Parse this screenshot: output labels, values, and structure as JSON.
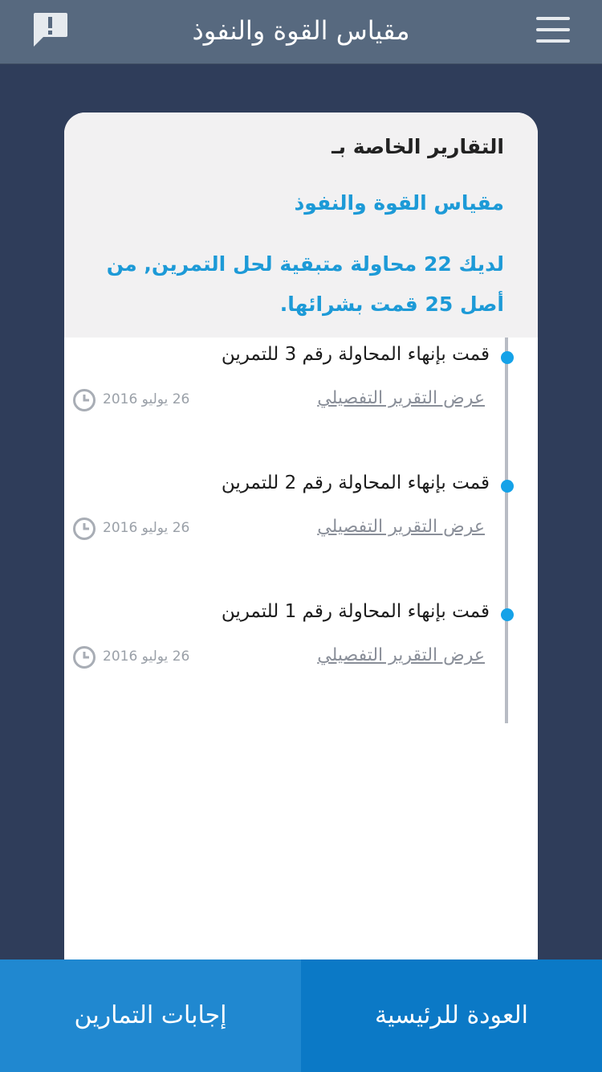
{
  "header": {
    "title": "مقياس القوة والنفوذ",
    "menu_icon": "hamburger-menu-icon",
    "report_icon": "exclamation-chat-icon"
  },
  "card": {
    "title": "التقارير الخاصة بـ",
    "subtitle": "مقياس القوة والنفوذ",
    "note": "لديك 22 محاولة متبقية لحل التمرين, من أصل 25 قمت بشرائها."
  },
  "timeline": [
    {
      "text": "قمت بإنهاء المحاولة رقم 3 للتمرين",
      "link": "عرض التقرير التفصيلي",
      "date": "26 يوليو 2016"
    },
    {
      "text": "قمت بإنهاء المحاولة رقم 2 للتمرين",
      "link": "عرض التقرير التفصيلي",
      "date": "26 يوليو 2016"
    },
    {
      "text": "قمت بإنهاء المحاولة رقم 1 للتمرين",
      "link": "عرض التقرير التفصيلي",
      "date": "26 يوليو 2016"
    }
  ],
  "footer": {
    "home_label": "العودة للرئيسية",
    "answers_label": "إجابات التمارين"
  },
  "colors": {
    "background": "#2f3d5a",
    "header": "#57697f",
    "accent": "#1d9ad7",
    "footer_left": "#2088d0",
    "footer_right": "#0b79c6"
  }
}
